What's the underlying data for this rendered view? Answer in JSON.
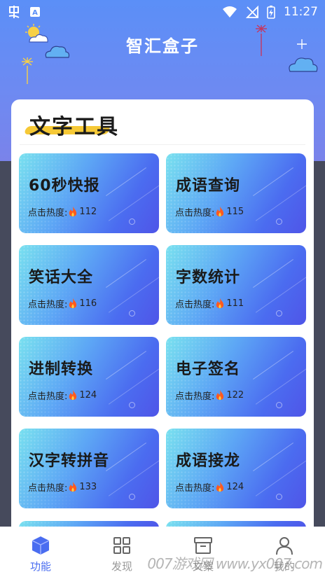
{
  "status_bar": {
    "time": "11:27",
    "left_icons": [
      "app-logo-icon",
      "a-badge-icon"
    ],
    "right_icons": [
      "wifi-icon",
      "signal-off-icon",
      "battery-charging-icon"
    ]
  },
  "header": {
    "title": "智汇盒子"
  },
  "section": {
    "title": "文字工具"
  },
  "heat_label": "点击热度:",
  "tools": [
    {
      "name": "60秒快报",
      "heat": "112"
    },
    {
      "name": "成语查询",
      "heat": "115"
    },
    {
      "name": "笑话大全",
      "heat": "116"
    },
    {
      "name": "字数统计",
      "heat": "111"
    },
    {
      "name": "进制转换",
      "heat": "124"
    },
    {
      "name": "电子签名",
      "heat": "122"
    },
    {
      "name": "汉字转拼音",
      "heat": "133"
    },
    {
      "name": "成语接龙",
      "heat": "124"
    }
  ],
  "bottom_nav": [
    {
      "label": "功能",
      "icon": "cube-icon",
      "active": true
    },
    {
      "label": "发现",
      "icon": "grid-icon",
      "active": false
    },
    {
      "label": "文案",
      "icon": "archive-icon",
      "active": false
    },
    {
      "label": "我的",
      "icon": "user-icon",
      "active": false
    }
  ],
  "watermark": "007游戏网 www.yx007.com",
  "colors": {
    "accent": "#4a6df0",
    "header_top": "#5b8ff7",
    "underline": "#f6c936",
    "flame": "#ff5a1f"
  }
}
